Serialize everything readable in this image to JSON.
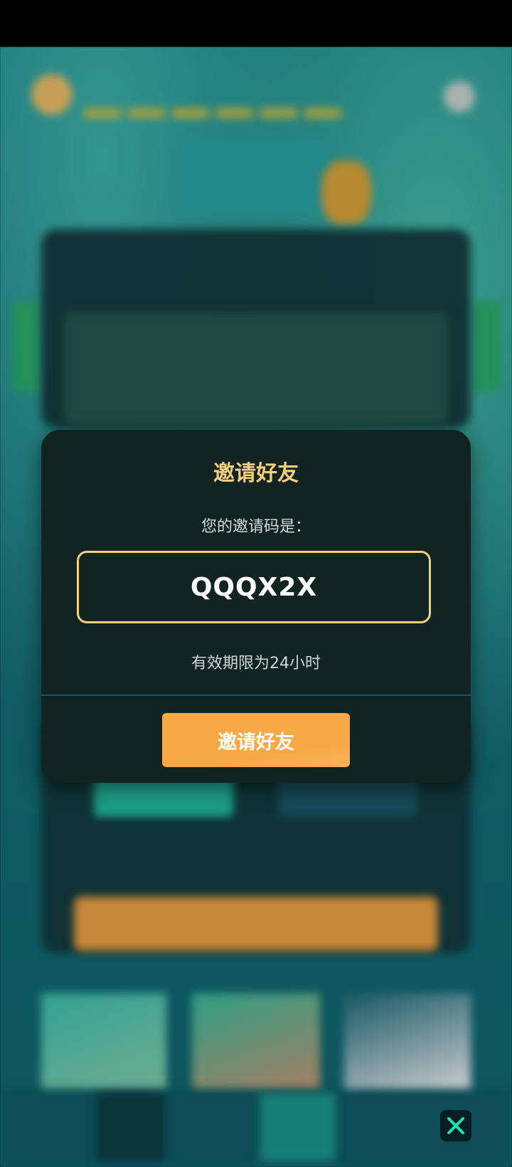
{
  "dialog": {
    "title": "邀请好友",
    "prompt": "您的邀请码是：",
    "invite_code": "QQQX2X",
    "validity": "有效期限为24小时",
    "invite_button_label": "邀请好友"
  },
  "colors": {
    "dialog_bg": "#122323",
    "title": "#f5cf79",
    "code_border": "#f5d27a",
    "button": "#f8a945",
    "close_icon": "#19e3b0"
  },
  "icons": {
    "close": "close-x-icon"
  }
}
